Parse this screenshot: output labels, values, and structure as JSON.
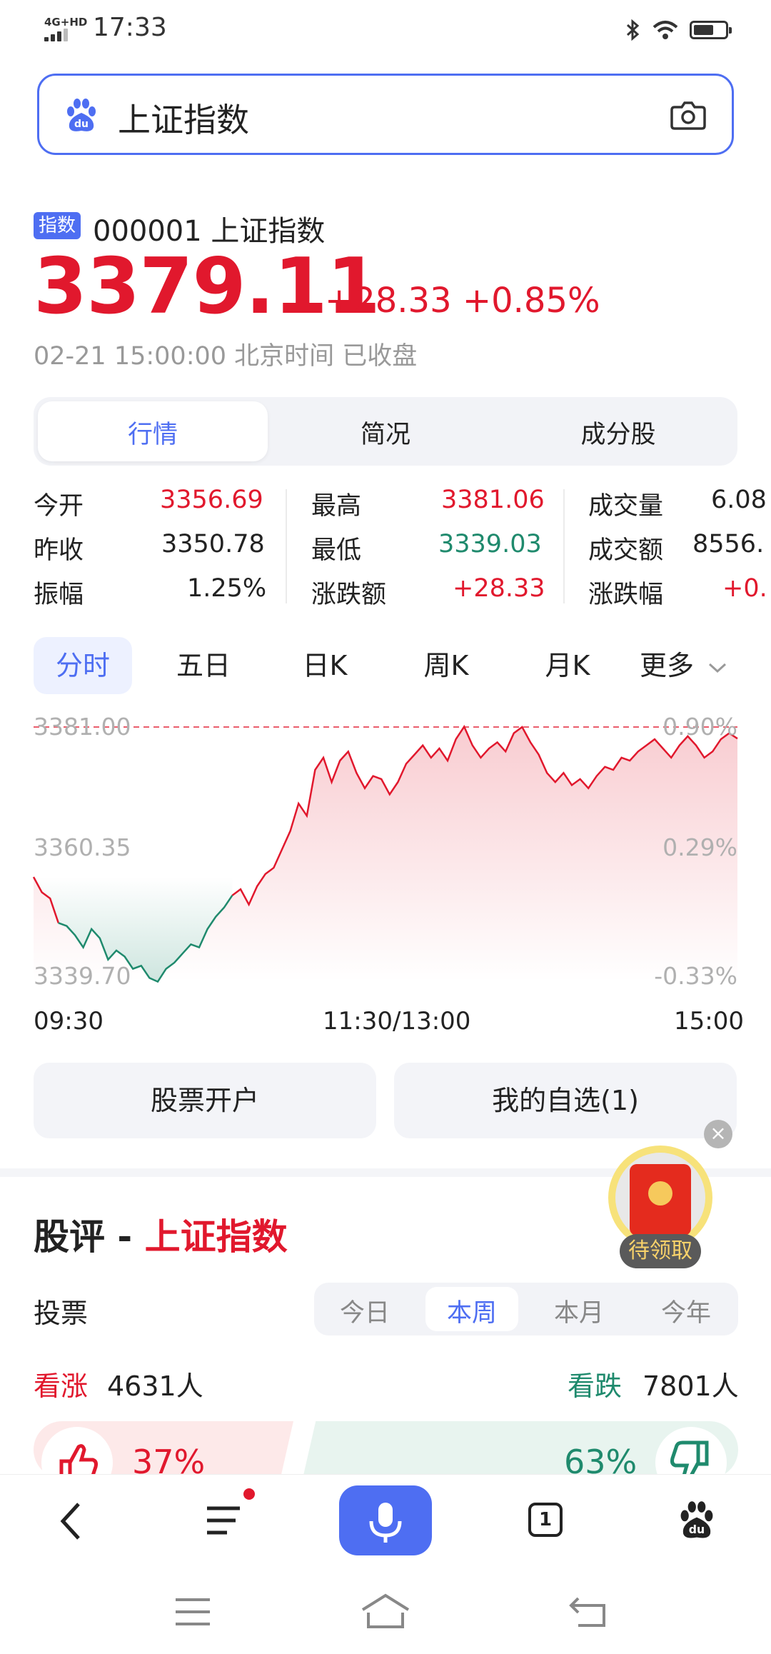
{
  "status_bar": {
    "network": "4G+HD",
    "time": "17:33",
    "battery_level": 0.55
  },
  "search": {
    "query": "上证指数"
  },
  "stock": {
    "tag": "指数",
    "code_name": "000001 上证指数",
    "price": "3379.11",
    "change": "+28.33 +0.85%",
    "timestamp": "02-21 15:00:00 北京时间 已收盘"
  },
  "tabs": [
    {
      "label": "行情"
    },
    {
      "label": "简况"
    },
    {
      "label": "成分股"
    }
  ],
  "stats": {
    "col1": [
      {
        "label": "今开",
        "value": "3356.69"
      },
      {
        "label": "昨收",
        "value": "3350.78"
      },
      {
        "label": "振幅",
        "value": "1.25%"
      }
    ],
    "col2": [
      {
        "label": "最高",
        "value": "3381.06"
      },
      {
        "label": "最低",
        "value": "3339.03"
      },
      {
        "label": "涨跌额",
        "value": "+28.33"
      }
    ],
    "col3": [
      {
        "label": "成交量",
        "value": "6.08"
      },
      {
        "label": "成交额",
        "value": "8556."
      },
      {
        "label": "涨跌幅",
        "value": "+0."
      }
    ]
  },
  "chart_tabs": [
    "分时",
    "五日",
    "日K",
    "周K",
    "月K",
    "更多"
  ],
  "chart_data": {
    "type": "line",
    "y_labels_left": [
      "3381.00",
      "3360.35",
      "3339.70"
    ],
    "y_labels_right": [
      "0.90%",
      "0.29%",
      "-0.33%"
    ],
    "x_labels": [
      "09:30",
      "11:30/13:00",
      "15:00"
    ],
    "ylim": [
      3339.7,
      3381.0
    ],
    "series": [
      {
        "values": [
          3356.5,
          3354.0,
          3353.0,
          3349.0,
          3348.5,
          3347.0,
          3345.0,
          3348.0,
          3346.5,
          3343.0,
          3344.5,
          3343.5,
          3341.5,
          3342.0,
          3340.0,
          3339.4,
          3341.5,
          3342.5,
          3344.0,
          3345.5,
          3345.0,
          3348.0,
          3350.0,
          3351.5,
          3353.5,
          3354.5,
          3352.0,
          3355.0,
          3357.0,
          3358.0,
          3361.0,
          3364.0,
          3368.5,
          3366.5,
          3374.0,
          3376.0,
          3372.0,
          3375.5,
          3377.0,
          3373.5,
          3371.0,
          3373.0,
          3372.5,
          3370.0,
          3372.0,
          3375.0,
          3376.5,
          3378.0,
          3376.0,
          3377.5,
          3375.5,
          3379.0,
          3381.06,
          3378.0,
          3376.0,
          3377.5,
          3378.5,
          3377.0,
          3380.0,
          3381.0,
          3378.5,
          3376.5,
          3373.5,
          3372.0,
          3373.5,
          3371.5,
          3372.5,
          3371.0,
          3373.0,
          3374.5,
          3374.0,
          3376.0,
          3375.5,
          3377.0,
          3378.0,
          3379.0,
          3377.5,
          3376.0,
          3378.0,
          3379.5,
          3378.0,
          3376.0,
          3377.0,
          3379.0,
          3380.0,
          3379.11
        ]
      }
    ],
    "reference": 3381.0
  },
  "buttons": {
    "open_account": "股票开户",
    "watchlist": "我的自选(1)"
  },
  "red_packet": {
    "label": "待领取"
  },
  "comments": {
    "title_prefix": "股评 -",
    "title_highlight": "上证指数",
    "vote_label": "投票",
    "periods": [
      "今日",
      "本周",
      "本月",
      "今年"
    ],
    "up_label": "看涨",
    "up_count": "4631人",
    "down_label": "看跌",
    "down_count": "7801人",
    "up_pct": "37%",
    "down_pct": "63%"
  },
  "bottom_nav": {
    "tab_count": "1"
  },
  "colors": {
    "accent": "#4e6ef2",
    "up": "#e1182d",
    "down": "#1f8a6d"
  }
}
